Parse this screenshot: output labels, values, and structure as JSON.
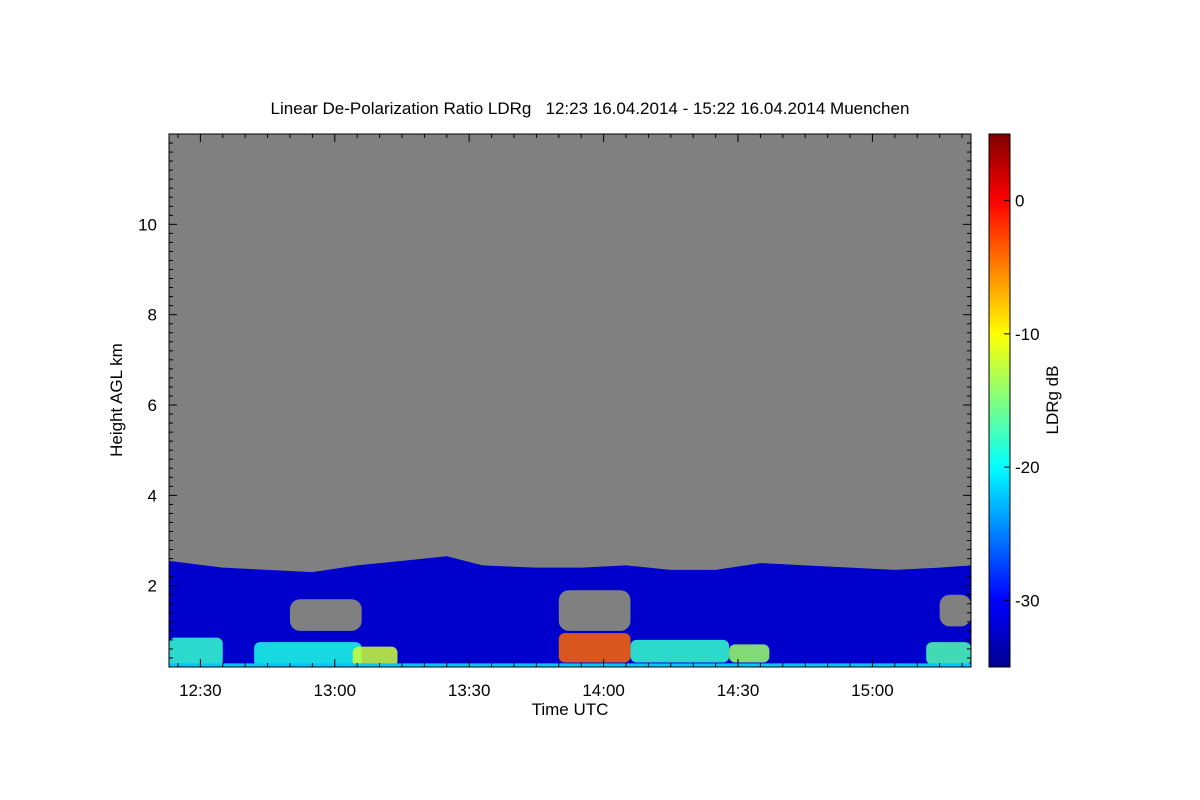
{
  "chart_data": {
    "type": "heatmap",
    "title": "Linear De-Polarization Ratio LDRg   12:23 16.04.2014 - 15:22 16.04.2014 Muenchen",
    "xlabel": "Time UTC",
    "ylabel": "Height AGL km",
    "colorbar_label": "LDRg dB",
    "x_range_utc": [
      "12:23",
      "15:22"
    ],
    "xlim_minutes": [
      743,
      922
    ],
    "ylim_km": [
      0.2,
      12.0
    ],
    "x_ticks": [
      {
        "t": 750,
        "label": "12:30"
      },
      {
        "t": 780,
        "label": "13:00"
      },
      {
        "t": 810,
        "label": "13:30"
      },
      {
        "t": 840,
        "label": "14:00"
      },
      {
        "t": 870,
        "label": "14:30"
      },
      {
        "t": 900,
        "label": "15:00"
      }
    ],
    "y_ticks": [
      {
        "v": 2,
        "label": "2"
      },
      {
        "v": 4,
        "label": "4"
      },
      {
        "v": 6,
        "label": "6"
      },
      {
        "v": 8,
        "label": "8"
      },
      {
        "v": 10,
        "label": "10"
      }
    ],
    "colorbar_range_db": [
      -35,
      5
    ],
    "colorbar_ticks": [
      {
        "v": 0,
        "label": "0"
      },
      {
        "v": -10,
        "label": "-10"
      },
      {
        "v": -20,
        "label": "-20"
      },
      {
        "v": -30,
        "label": "-30"
      }
    ],
    "colormap": "jet",
    "no_signal_color": "#808080",
    "background_ldr_db": -32,
    "signal_top_profile_km": [
      {
        "t": 743,
        "h": 2.55
      },
      {
        "t": 755,
        "h": 2.4
      },
      {
        "t": 765,
        "h": 2.35
      },
      {
        "t": 775,
        "h": 2.3
      },
      {
        "t": 785,
        "h": 2.45
      },
      {
        "t": 795,
        "h": 2.55
      },
      {
        "t": 805,
        "h": 2.65
      },
      {
        "t": 813,
        "h": 2.45
      },
      {
        "t": 825,
        "h": 2.4
      },
      {
        "t": 835,
        "h": 2.4
      },
      {
        "t": 845,
        "h": 2.45
      },
      {
        "t": 855,
        "h": 2.35
      },
      {
        "t": 865,
        "h": 2.35
      },
      {
        "t": 875,
        "h": 2.5
      },
      {
        "t": 885,
        "h": 2.45
      },
      {
        "t": 895,
        "h": 2.4
      },
      {
        "t": 905,
        "h": 2.35
      },
      {
        "t": 915,
        "h": 2.4
      },
      {
        "t": 922,
        "h": 2.45
      }
    ],
    "high_ldr_regions": [
      {
        "t0": 743,
        "t1": 755,
        "h0": 0.2,
        "h1": 0.85,
        "ldr_db": -18
      },
      {
        "t0": 762,
        "t1": 786,
        "h0": 0.2,
        "h1": 0.75,
        "ldr_db": -19
      },
      {
        "t0": 784,
        "t1": 794,
        "h0": 0.2,
        "h1": 0.65,
        "ldr_db": -12
      },
      {
        "t0": 830,
        "t1": 846,
        "h0": 0.3,
        "h1": 0.95,
        "ldr_db": -4
      },
      {
        "t0": 846,
        "t1": 868,
        "h0": 0.3,
        "h1": 0.8,
        "ldr_db": -18
      },
      {
        "t0": 868,
        "t1": 877,
        "h0": 0.3,
        "h1": 0.7,
        "ldr_db": -14
      },
      {
        "t0": 912,
        "t1": 922,
        "h0": 0.25,
        "h1": 0.75,
        "ldr_db": -17
      }
    ],
    "no_signal_patches": [
      {
        "t0": 770,
        "t1": 786,
        "h0": 1.0,
        "h1": 1.7
      },
      {
        "t0": 830,
        "t1": 846,
        "h0": 1.0,
        "h1": 1.9
      },
      {
        "t0": 915,
        "t1": 922,
        "h0": 1.1,
        "h1": 1.8
      }
    ]
  }
}
